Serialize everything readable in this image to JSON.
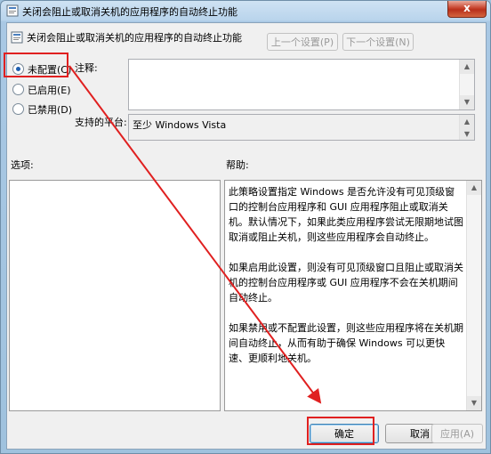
{
  "window": {
    "title": "关闭会阻止或取消关机的应用程序的自动终止功能",
    "close_label": "x"
  },
  "header": {
    "policy_name": "关闭会阻止或取消关机的应用程序的自动终止功能",
    "prev_label": "上一个设置(P)",
    "next_label": "下一个设置(N)"
  },
  "options": [
    {
      "label": "未配置(C)",
      "checked": true
    },
    {
      "label": "已启用(E)",
      "checked": false
    },
    {
      "label": "已禁用(D)",
      "checked": false
    }
  ],
  "comment_label": "注释:",
  "platform_label": "支持的平台:",
  "platform_value": "至少 Windows Vista",
  "options_section_label": "选项:",
  "help_section_label": "帮助:",
  "help_text": "此策略设置指定 Windows 是否允许没有可见顶级窗口的控制台应用程序和 GUI 应用程序阻止或取消关机。默认情况下，如果此类应用程序尝试无限期地试图取消或阻止关机，则这些应用程序会自动终止。\n\n如果启用此设置，则没有可见顶级窗口且阻止或取消关机的控制台应用程序或 GUI 应用程序不会在关机期间自动终止。\n\n如果禁用或不配置此设置，则这些应用程序将在关机期间自动终止，从而有助于确保 Windows 可以更快速、更顺利地关机。",
  "footer": {
    "ok_label": "确定",
    "cancel_label": "取消",
    "apply_label": "应用(A)"
  },
  "colors": {
    "annotation": "#e02020",
    "radio_checked": "#1f5fb0"
  }
}
